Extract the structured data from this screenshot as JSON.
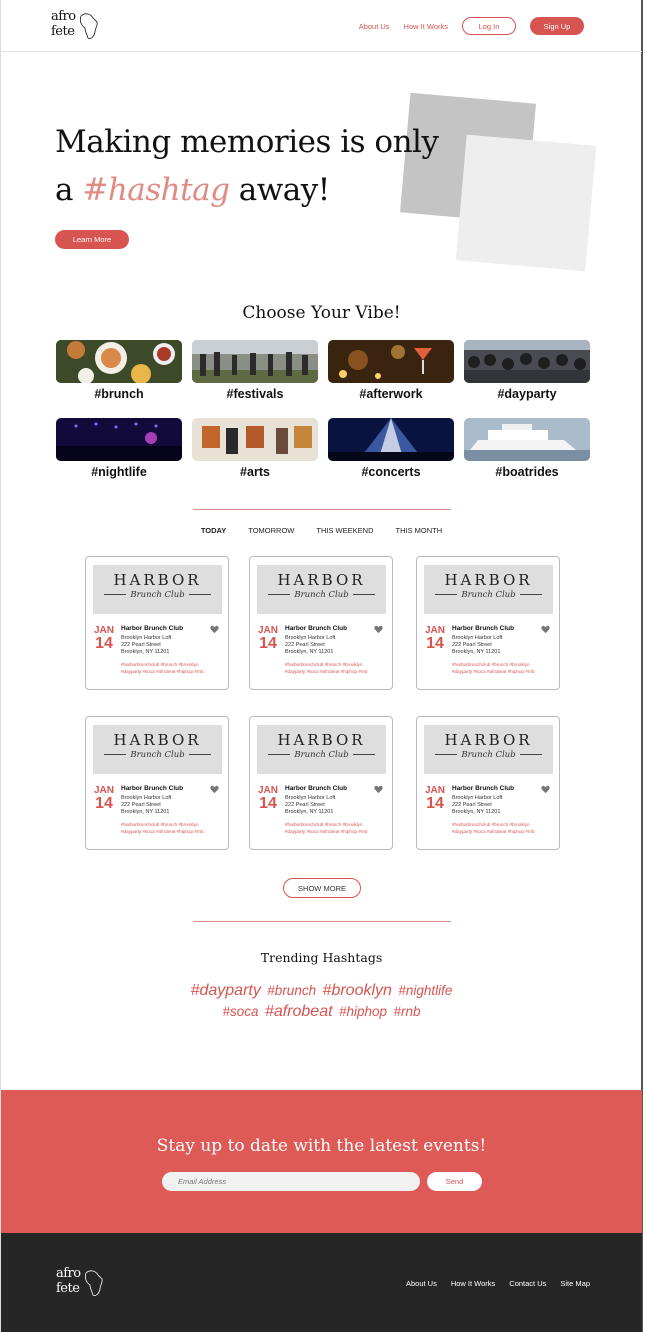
{
  "header": {
    "logo_line1": "afro",
    "logo_line2": "fete",
    "nav_about": "About Us",
    "nav_how": "How It Works",
    "login": "Log In",
    "signup": "Sign Up"
  },
  "hero": {
    "line1": "Making memories is only",
    "line2_pre": "a ",
    "line2_hash": "#hashtag",
    "line2_post": " away!",
    "cta": "Learn More"
  },
  "vibes": {
    "title": "Choose Your Vibe!",
    "items": [
      {
        "label": "#brunch"
      },
      {
        "label": "#festivals"
      },
      {
        "label": "#afterwork"
      },
      {
        "label": "#dayparty"
      },
      {
        "label": "#nightlife"
      },
      {
        "label": "#arts"
      },
      {
        "label": "#concerts"
      },
      {
        "label": "#boatrides"
      }
    ]
  },
  "tabs": [
    "TODAY",
    "TOMORROW",
    "THIS WEEKEND",
    "THIS MONTH"
  ],
  "event": {
    "banner_main": "HARBOR",
    "banner_sub": "Brunch Club",
    "month": "JAN",
    "day": "14",
    "name": "Harbor Brunch Club",
    "venue": "Brooklyn Harbor Loft",
    "street": "222 Pearl Street",
    "city": "Brooklyn, NY 11201",
    "tags1": "#harborbrunchclub #brunch #brooklyn",
    "tags2": "#dayparty #soca #afrobeat #hiphop #rnb"
  },
  "show_more": "SHOW MORE",
  "trending": {
    "title": "Trending Hashtags",
    "row1": [
      "#dayparty",
      "#brunch",
      "#brooklyn",
      "#nightlife"
    ],
    "row2": [
      "#soca",
      "#afrobeat",
      "#hiphop",
      "#rnb"
    ]
  },
  "newsletter": {
    "title": "Stay up to date with the latest events!",
    "placeholder": "Email Address",
    "send": "Send"
  },
  "footer": {
    "links": [
      "About Us",
      "How It Works",
      "Contact Us",
      "Site Map"
    ]
  },
  "colors": {
    "accent": "#d85450",
    "footer_bg": "#262626"
  }
}
